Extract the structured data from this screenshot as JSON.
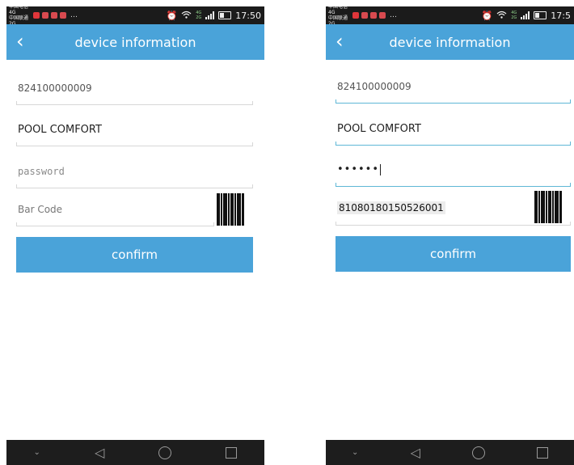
{
  "left": {
    "status": {
      "carrier1": "中国电信 4G",
      "carrier2": "中国联通 2G",
      "misc": "… ",
      "net_top": "4G",
      "net_bottom": "2G",
      "time": "17:50"
    },
    "appbar": {
      "back": "‹",
      "title": "device information"
    },
    "fields": {
      "device_id": "824100000009",
      "device_name": "POOL COMFORT",
      "password_placeholder": "password",
      "barcode_placeholder": "Bar Code"
    },
    "confirm_label": "confirm"
  },
  "right": {
    "status": {
      "carrier1": "中国电信 4G",
      "carrier2": "中国联通 2G",
      "misc": "… ",
      "net_top": "4G",
      "net_bottom": "2G",
      "time": "17:5"
    },
    "appbar": {
      "back": "‹",
      "title": "device information"
    },
    "fields": {
      "device_id": "824100000009",
      "device_name": "POOL COMFORT",
      "password_masked": "••••••",
      "barcode_value": "81080180150526001"
    },
    "confirm_label": "confirm"
  },
  "navbar": {
    "chevron": "⌄",
    "back": "◁"
  },
  "colors": {
    "accent": "#4aa3d9",
    "statusbar": "#1b1b1b",
    "navbar": "#1d1d1d",
    "active_underline": "#5fb7d6"
  },
  "icons": [
    "back-arrow-icon",
    "alarm-icon",
    "wifi-icon",
    "signal-icon",
    "battery-icon",
    "barcode-icon",
    "home-icon",
    "recents-icon"
  ]
}
